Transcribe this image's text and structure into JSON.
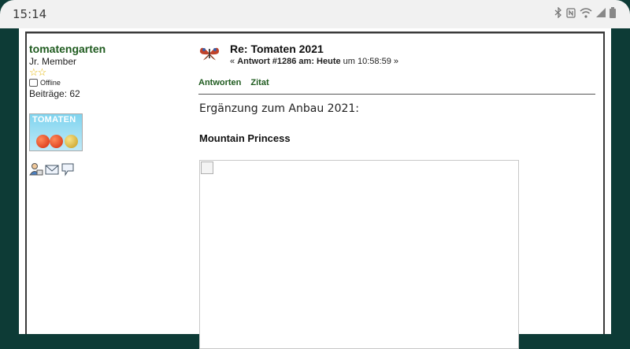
{
  "statusbar": {
    "time": "15:14",
    "icons": [
      "bluetooth-icon",
      "nfc-icon",
      "wifi-icon",
      "signal-icon",
      "battery-icon"
    ]
  },
  "poster": {
    "name": "tomatengarten",
    "rank": "Jr. Member",
    "stars": "☆☆",
    "status": "Offline",
    "posts": "Beiträge: 62",
    "avatar_title": "TOMATEN",
    "icons": [
      "profile-icon",
      "email-icon",
      "message-icon"
    ]
  },
  "post": {
    "subject": "Re: Tomaten 2021",
    "meta_prefix": "« ",
    "meta_bold": "Antwort #1286 am: Heute",
    "meta_suffix": " um 10:58:59 »",
    "actions": {
      "reply": "Antworten",
      "quote": "Zitat"
    },
    "body": "Ergänzung zum Anbau 2021:",
    "heading": "Mountain Princess"
  },
  "colors": {
    "background": "#0d3b36",
    "username": "#1f5b1f",
    "star": "#e3b500"
  }
}
